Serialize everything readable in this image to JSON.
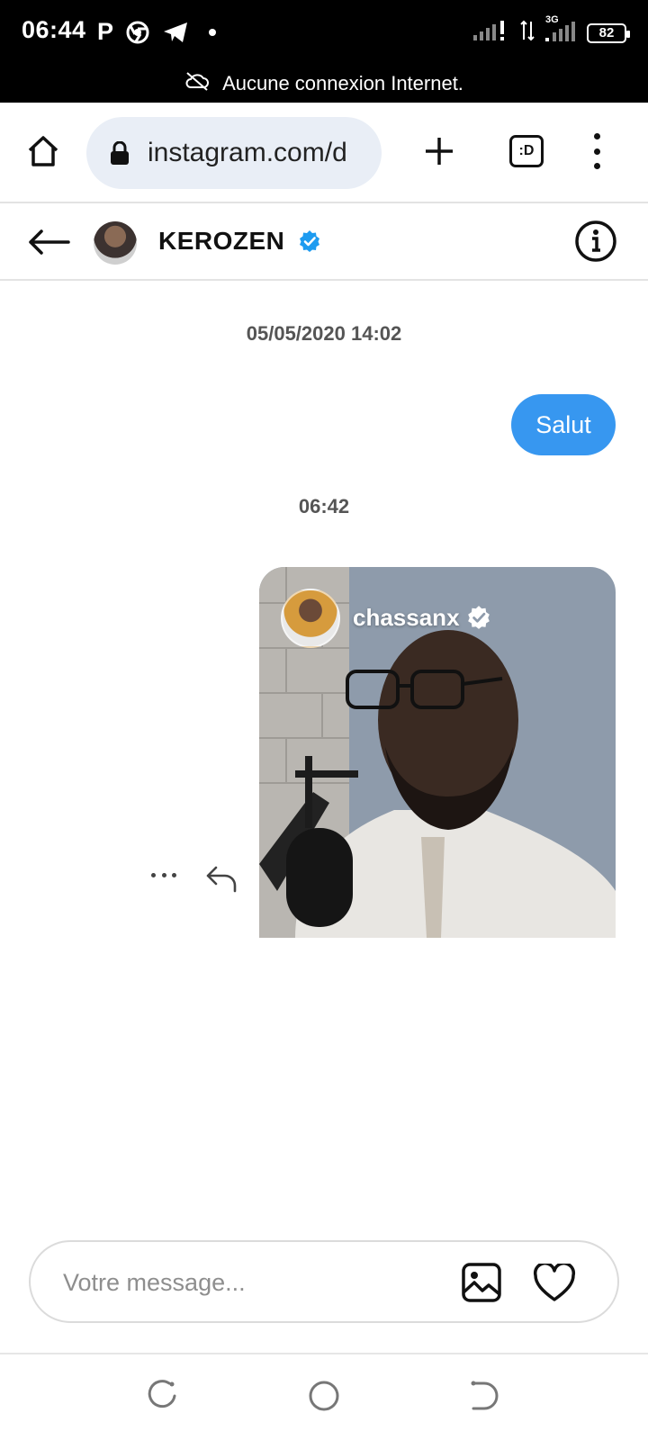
{
  "status_bar": {
    "time": "06:44",
    "network_type": "3G",
    "battery_level": "82"
  },
  "offline_banner": {
    "text": "Aucune connexion Internet."
  },
  "browser": {
    "url": "instagram.com/d",
    "tab_counter_label": ":D"
  },
  "chat_header": {
    "contact_name": "KEROZEN",
    "verified": true
  },
  "conversation": {
    "timestamp_1": "05/05/2020 14:02",
    "outgoing_message": "Salut",
    "timestamp_2": "06:42",
    "shared_post": {
      "username": "chassanx",
      "verified": true
    }
  },
  "composer": {
    "placeholder": "Votre message..."
  },
  "colors": {
    "accent_blue": "#3797f0",
    "verified_blue": "#1d9bf0"
  }
}
